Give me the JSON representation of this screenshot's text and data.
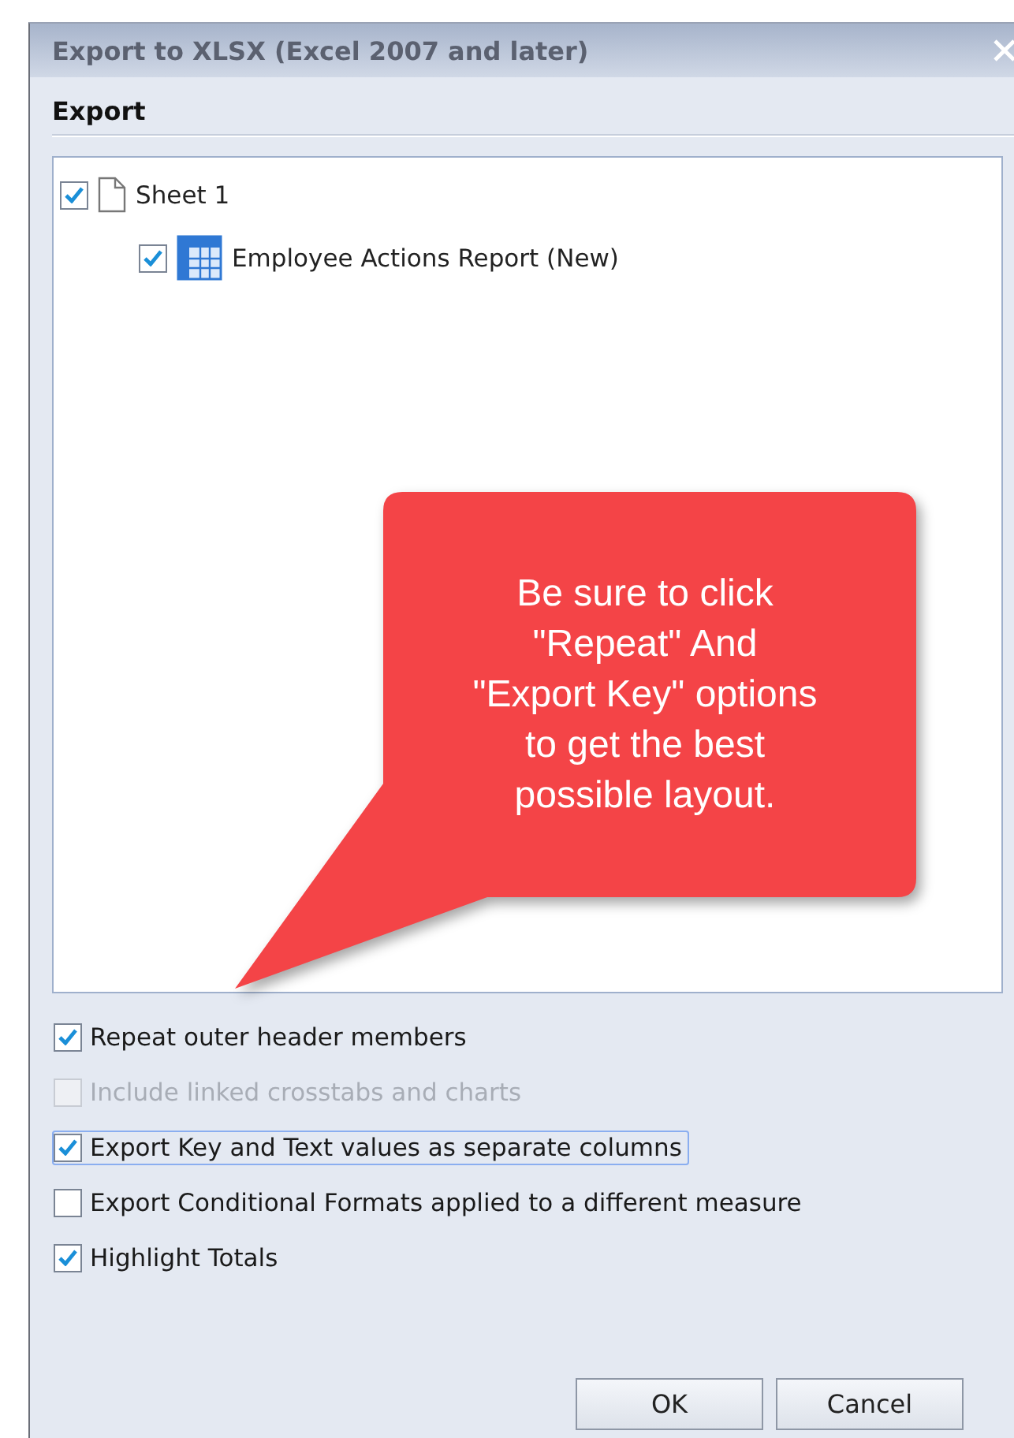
{
  "window": {
    "title": "Export to XLSX (Excel 2007 and later)"
  },
  "section_title": "Export",
  "tree": [
    {
      "label": "Sheet 1",
      "kind": "sheet",
      "checked": true,
      "children": [
        {
          "label": "Employee Actions Report (New)",
          "kind": "table",
          "checked": true
        }
      ]
    }
  ],
  "callout": {
    "text": "Be sure to click\n\"Repeat\" And\n\"Export Key\" options\nto get the best\npossible layout."
  },
  "options": [
    {
      "label": "Repeat outer header members",
      "checked": true,
      "disabled": false,
      "focused": false
    },
    {
      "label": "Include linked crosstabs and charts",
      "checked": false,
      "disabled": true,
      "focused": false
    },
    {
      "label": "Export Key and Text values as separate columns",
      "checked": true,
      "disabled": false,
      "focused": true
    },
    {
      "label": "Export Conditional Formats applied to a different measure",
      "checked": false,
      "disabled": false,
      "focused": false
    },
    {
      "label": "Highlight Totals",
      "checked": true,
      "disabled": false,
      "focused": false
    }
  ],
  "buttons": [
    "OK",
    "Cancel"
  ]
}
